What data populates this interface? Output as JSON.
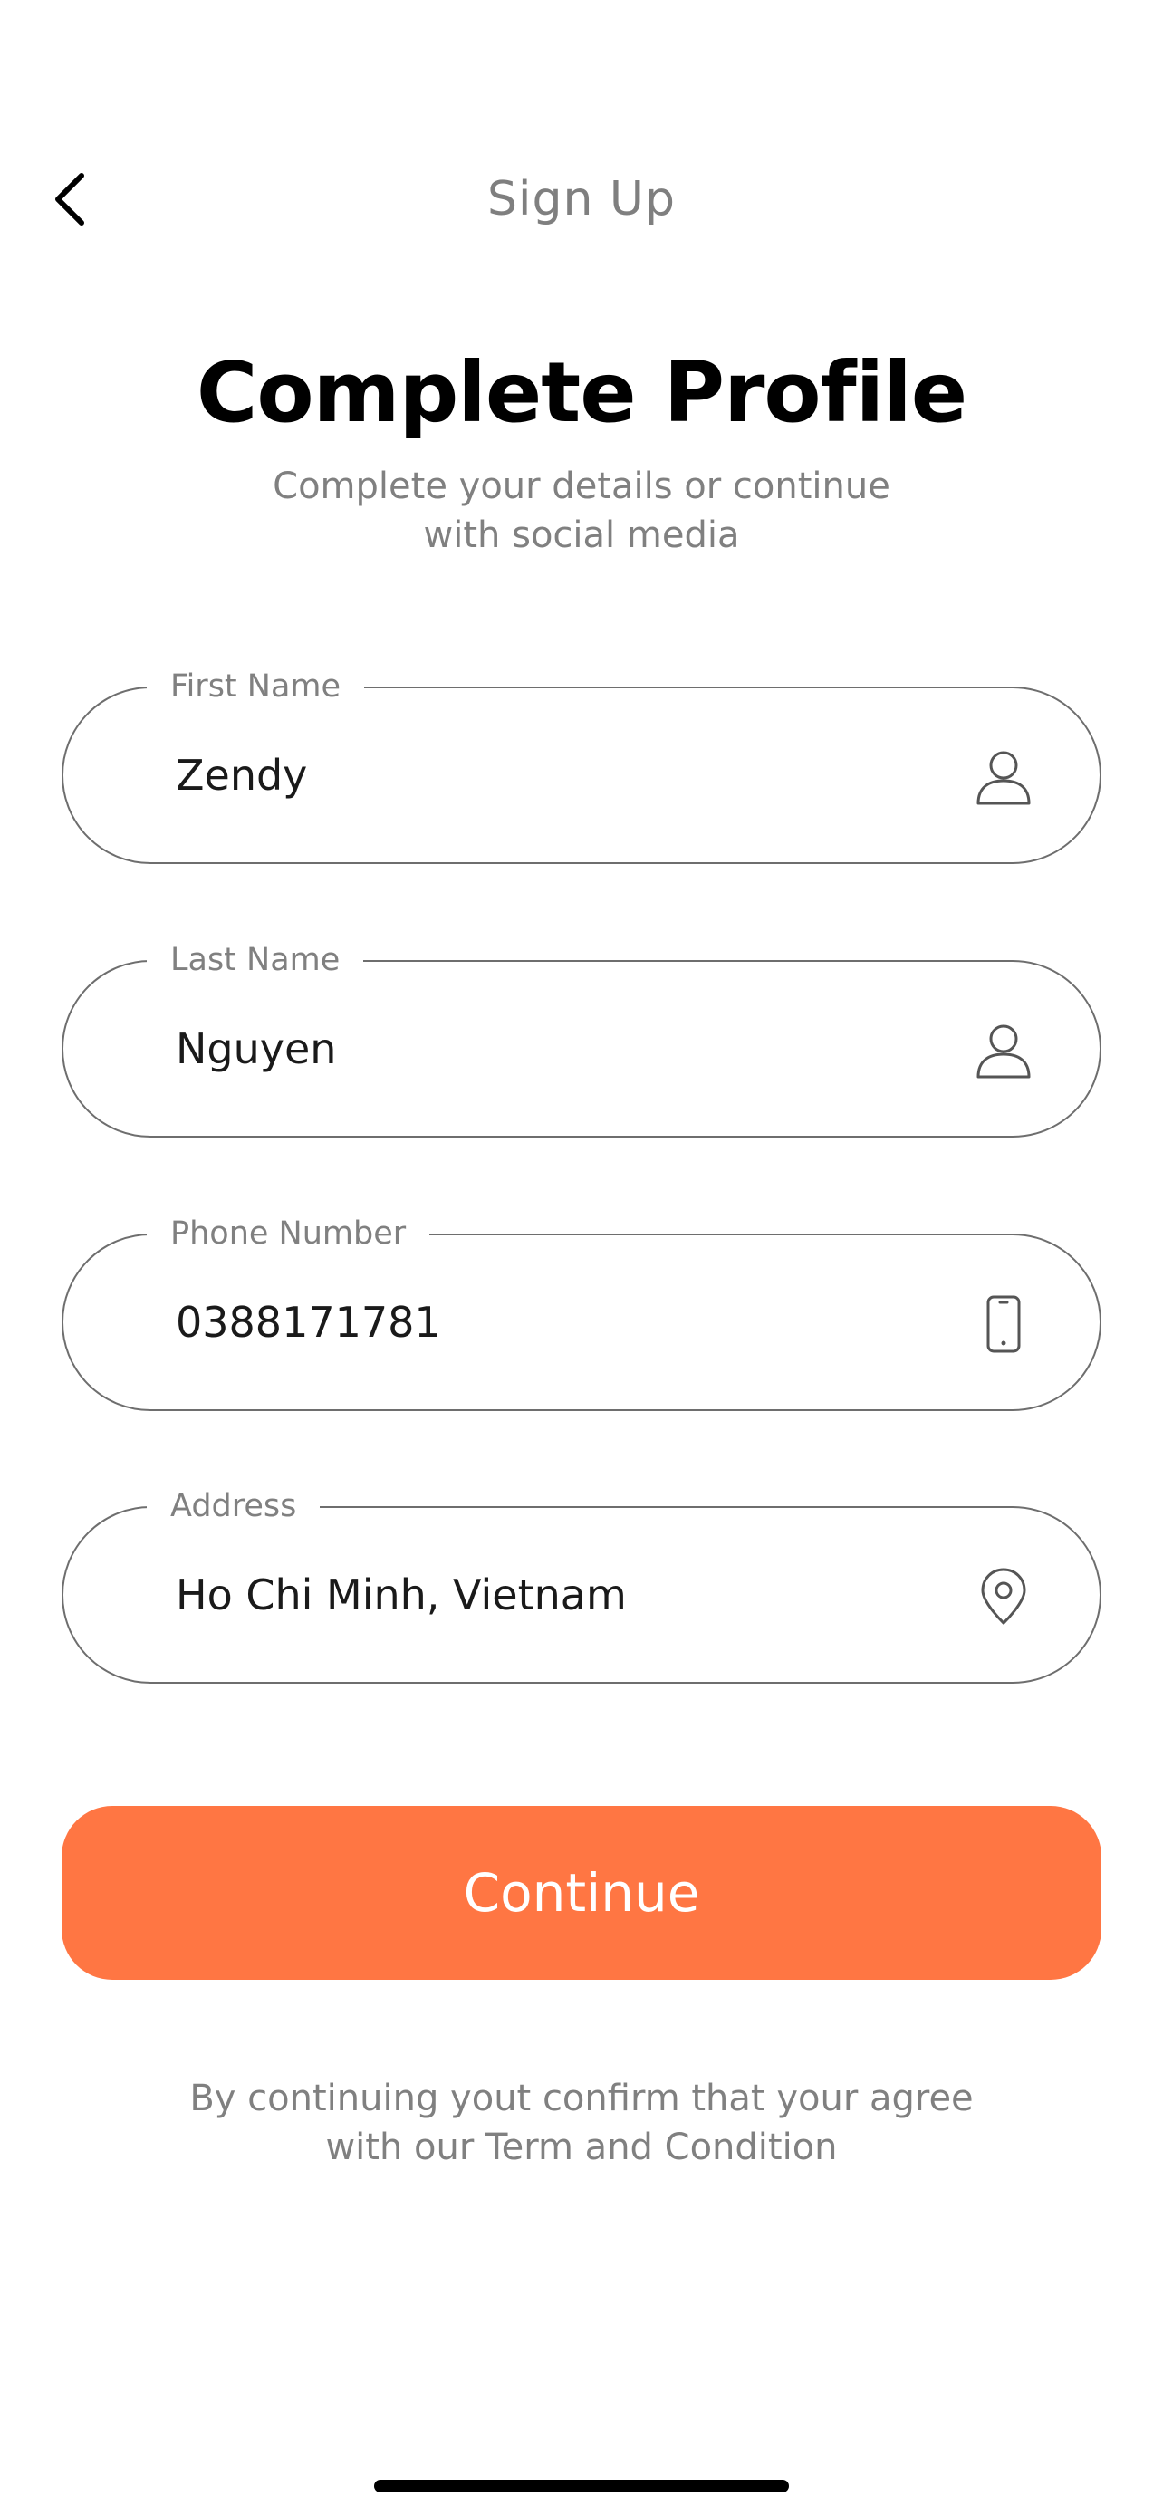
{
  "header": {
    "title": "Sign Up",
    "back_icon": "chevron-left-icon"
  },
  "main": {
    "title": "Complete Profile",
    "subtitle": "Complete your details or continue with social media"
  },
  "form": {
    "first_name": {
      "label": "First Name",
      "value": "Zendy",
      "icon": "user-icon"
    },
    "last_name": {
      "label": "Last Name",
      "value": "Nguyen",
      "icon": "user-icon"
    },
    "phone": {
      "label": "Phone Number",
      "value": "0388171781",
      "icon": "phone-icon"
    },
    "address": {
      "label": "Address",
      "value": "Ho Chi Minh, Vietnam",
      "icon": "location-pin-icon"
    }
  },
  "actions": {
    "continue_label": "Continue"
  },
  "footer": {
    "text": "By continuing yout confirm that your agree with our Term and Condition"
  },
  "colors": {
    "accent": "#ff7643",
    "field_border": "#6e6e6e",
    "muted_text": "#808080"
  }
}
